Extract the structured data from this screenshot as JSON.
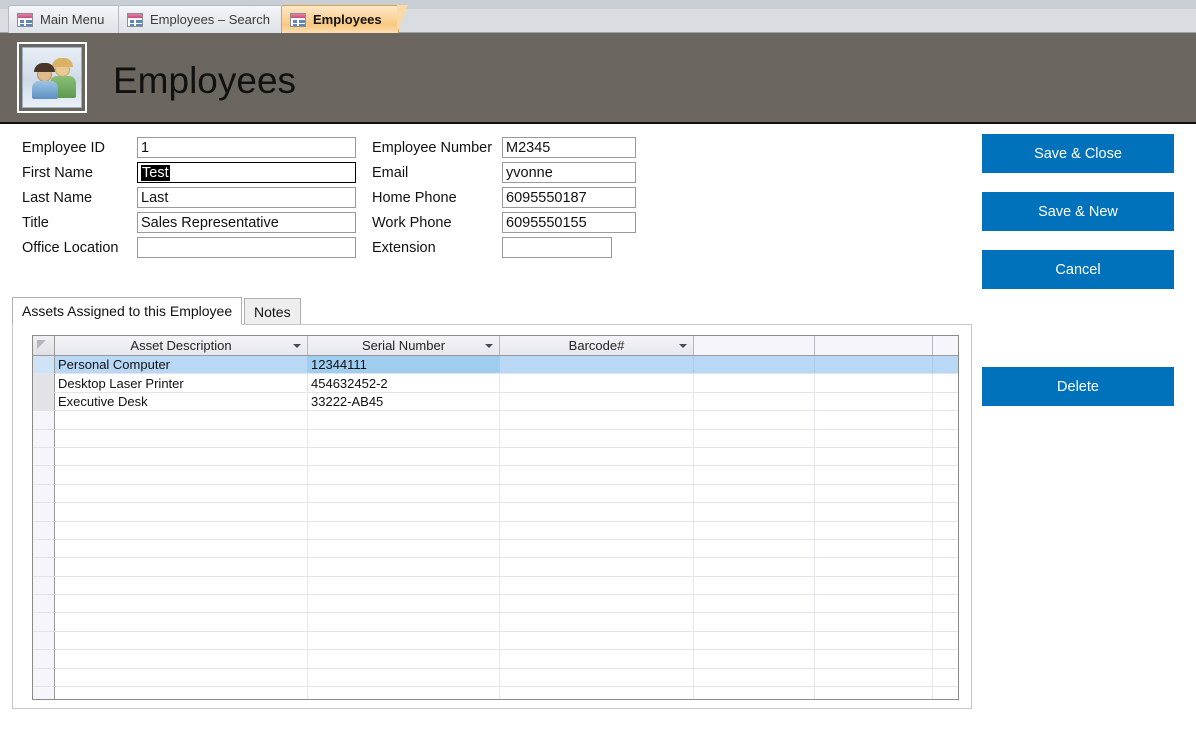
{
  "window": {
    "doc_tabs": [
      {
        "label": "Main Menu",
        "icon": "form-icon",
        "active": false
      },
      {
        "label": "Employees – Search",
        "icon": "form-icon",
        "active": false
      },
      {
        "label": "Employees",
        "icon": "form-icon",
        "active": true
      }
    ]
  },
  "header": {
    "title": "Employees",
    "icon": "employees-people-icon",
    "background_color": "#6b665f"
  },
  "form": {
    "left_fields": [
      {
        "label": "Employee ID",
        "value": "1",
        "selected": false,
        "empty": false
      },
      {
        "label": "First Name",
        "value": "Test",
        "selected": true,
        "empty": false
      },
      {
        "label": "Last Name",
        "value": "Last",
        "selected": false,
        "empty": false
      },
      {
        "label": "Title",
        "value": "Sales Representative",
        "selected": false,
        "empty": false
      },
      {
        "label": "Office Location",
        "value": "",
        "selected": false,
        "empty": true
      }
    ],
    "right_fields": [
      {
        "label": "Employee Number",
        "value": "M2345",
        "empty": false
      },
      {
        "label": "Email",
        "value": "yvonne",
        "empty": false
      },
      {
        "label": "Home Phone",
        "value": "6095550187",
        "empty": false
      },
      {
        "label": "Work Phone",
        "value": "6095550155",
        "empty": false
      },
      {
        "label": "Extension",
        "value": "",
        "empty": true
      }
    ]
  },
  "actions": {
    "accent_color": "#0072bc",
    "buttons": [
      {
        "label": "Save & Close",
        "name": "save-and-close-button"
      },
      {
        "label": "Save & New",
        "name": "save-and-new-button"
      },
      {
        "label": "Cancel",
        "name": "cancel-button"
      },
      {
        "label": "Delete",
        "name": "delete-button"
      }
    ]
  },
  "tab_control": {
    "tabs": [
      {
        "label": "Assets Assigned to this Employee",
        "active": true
      },
      {
        "label": "Notes",
        "active": false
      }
    ]
  },
  "datasheet": {
    "columns": [
      "Asset Description",
      "Serial Number",
      "Barcode#"
    ],
    "rows": [
      {
        "Asset Description": "Personal Computer",
        "Serial Number": "12344111",
        "Barcode#": "",
        "selected": true,
        "current_field": "Serial Number"
      },
      {
        "Asset Description": "Desktop Laser Printer",
        "Serial Number": "454632452-2",
        "Barcode#": "",
        "selected": false
      },
      {
        "Asset Description": "Executive Desk",
        "Serial Number": "33222-AB45",
        "Barcode#": "",
        "selected": false
      }
    ],
    "empty_row_count": 16,
    "selection_highlight_color": "#b8d8f6"
  }
}
